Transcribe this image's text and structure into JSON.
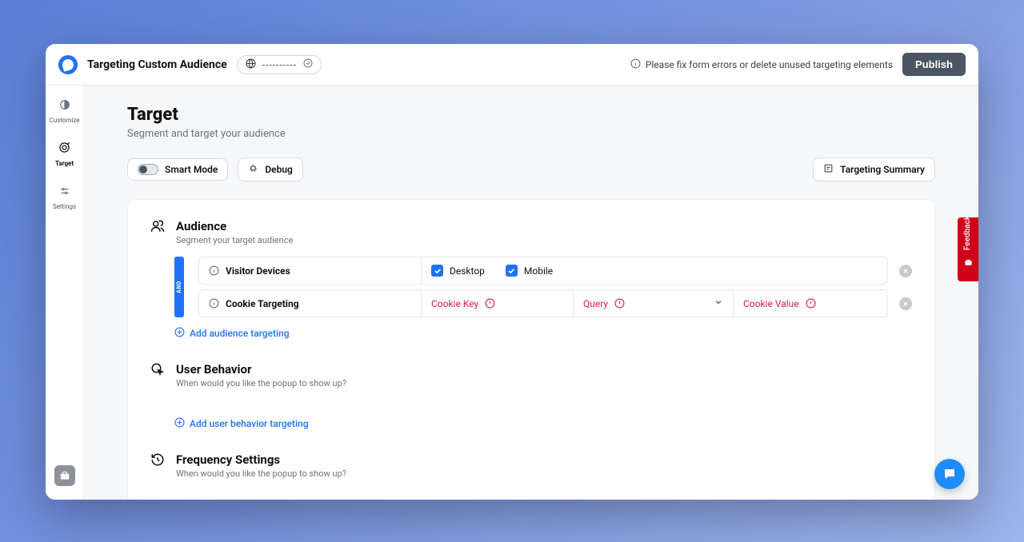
{
  "header": {
    "title": "Targeting Custom Audience",
    "pill_dashes": "----------",
    "warning": "Please fix form errors or delete unused targeting elements",
    "publish": "Publish"
  },
  "sidebar": {
    "items": [
      {
        "label": "Customize"
      },
      {
        "label": "Target"
      },
      {
        "label": "Settings"
      }
    ]
  },
  "page": {
    "title": "Target",
    "sub": "Segment and target your audience"
  },
  "toolbar": {
    "smart": "Smart Mode",
    "debug": "Debug",
    "summary": "Targeting Summary"
  },
  "audience": {
    "title": "Audience",
    "sub": "Segment your target audience",
    "and": "AND",
    "row1": {
      "label": "Visitor Devices",
      "opt1": "Desktop",
      "opt2": "Mobile"
    },
    "row2": {
      "label": "Cookie Targeting",
      "key": "Cookie Key",
      "query": "Query",
      "value": "Cookie Value"
    },
    "add": "Add audience targeting"
  },
  "behavior": {
    "title": "User Behavior",
    "sub": "When would you like the popup to show up?",
    "add": "Add user behavior targeting"
  },
  "frequency": {
    "title": "Frequency Settings",
    "sub": "When would you like the popup to show up?"
  },
  "feedback": "Feedback"
}
